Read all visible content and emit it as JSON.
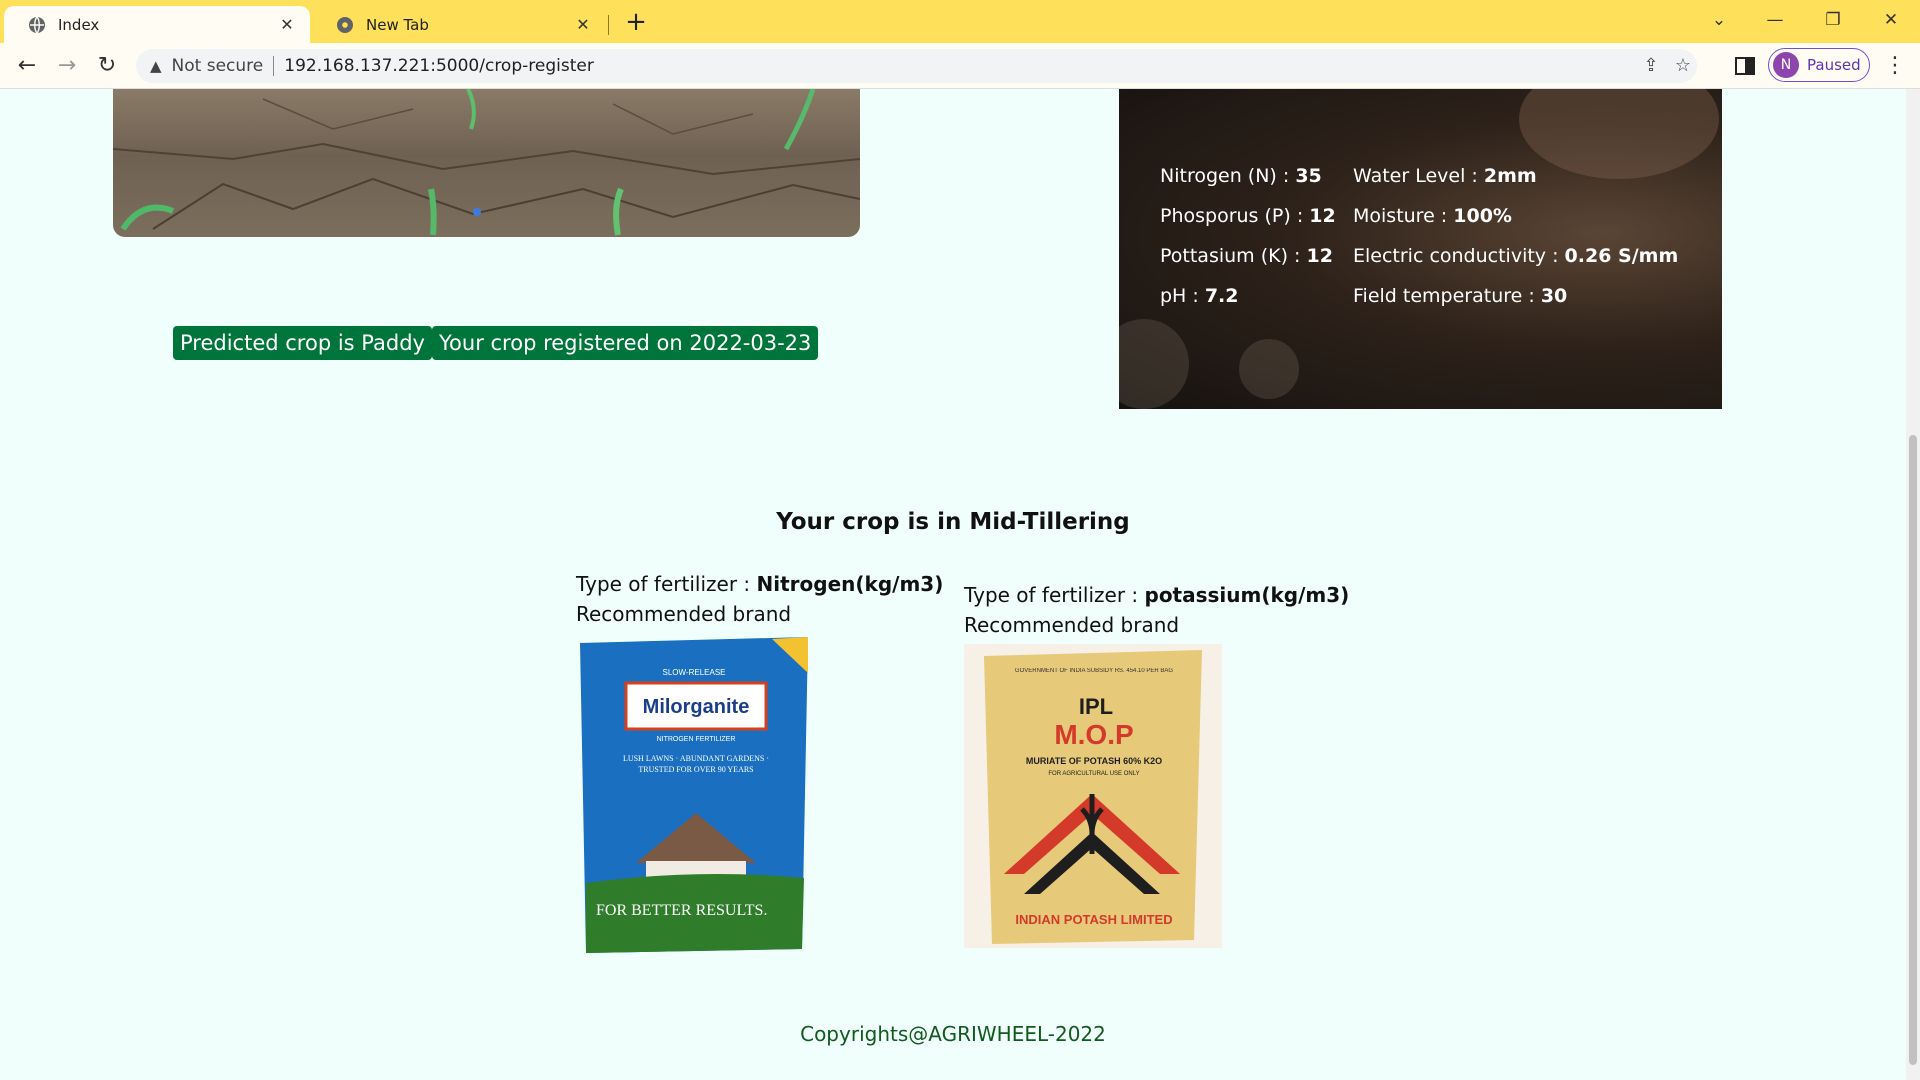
{
  "browser": {
    "tabs": [
      {
        "title": "Index",
        "active": true
      },
      {
        "title": "New Tab",
        "active": false
      }
    ],
    "security_label": "Not secure",
    "url": "192.168.137.221:5000/crop-register",
    "profile_initial": "N",
    "profile_status": "Paused"
  },
  "badges": {
    "predicted": "Predicted crop is Paddy",
    "registered": "Your crop registered on 2022-03-23"
  },
  "soil": {
    "items": [
      {
        "label": "Nitrogen (N) : ",
        "value": "35"
      },
      {
        "label": "Water Level : ",
        "value": "2mm"
      },
      {
        "label": "Phosporus (P) : ",
        "value": "12"
      },
      {
        "label": "Moisture : ",
        "value": "100%"
      },
      {
        "label": "Pottasium (K) : ",
        "value": "12"
      },
      {
        "label": "Electric conductivity : ",
        "value": "0.26 S/mm"
      },
      {
        "label": "pH : ",
        "value": "7.2"
      },
      {
        "label": "Field temperature : ",
        "value": "30"
      }
    ]
  },
  "stage": "Your crop is in Mid-Tillering",
  "fertilizers": [
    {
      "type_label": "Type of fertilizer : ",
      "type": "Nitrogen(kg/m3)",
      "brand_label": "Recommended brand",
      "bag": {
        "top_text": "SLOW-RELEASE",
        "brand": "Milorganite",
        "sub": "NITROGEN FERTILIZER",
        "tagline": "LUSH LAWNS · ABUNDANT GARDENS · TRUSTED FOR OVER 90 YEARS",
        "bottom": "FOR BETTER RESULTS.",
        "colors": {
          "main": "#1a6fc0",
          "grass": "#2f7d2a",
          "accent": "#d6401c"
        }
      }
    },
    {
      "type_label": "Type of fertilizer : ",
      "type": "potassium(kg/m3)",
      "brand_label": "Recommended brand",
      "bag": {
        "top_text": "GOVERNMENT OF INDIA SUBSIDY RS. 454.10 PER BAG",
        "brand": "IPL",
        "product": "M.O.P",
        "sub": "MURIATE OF POTASH 60% K2O",
        "note": "FOR AGRICULTURAL USE ONLY",
        "bottom": "INDIAN POTASH LIMITED",
        "colors": {
          "main": "#e7c97a",
          "red": "#d43a2a",
          "black": "#1e1e1e"
        }
      }
    }
  ],
  "footer": "Copyrights@AGRIWHEEL-2022"
}
